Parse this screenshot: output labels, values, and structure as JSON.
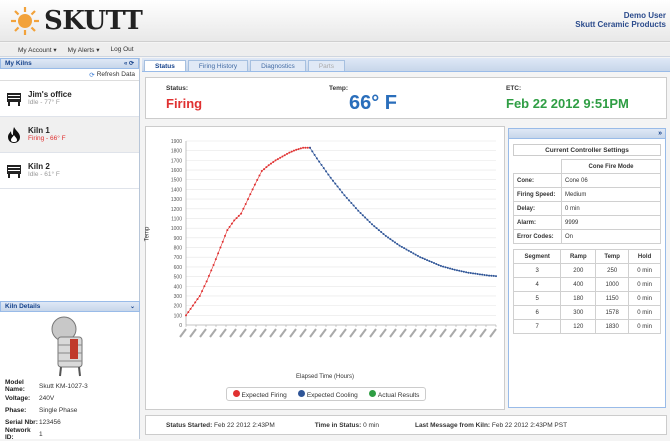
{
  "brand": {
    "name": "SKUTT"
  },
  "user": {
    "name": "Demo User",
    "company": "Skutt Ceramic Products"
  },
  "menu": {
    "account": "My Account ▾",
    "alerts": "My Alerts ▾",
    "logout": "Log Out"
  },
  "sidebar": {
    "title": "My Kilns",
    "refresh": "Refresh Data",
    "kilns": [
      {
        "name": "Jim's office",
        "status": "Idle  -  77° F"
      },
      {
        "name": "Kiln 1",
        "status": "Firing  -  66° F"
      },
      {
        "name": "Kiln 2",
        "status": "Idle  -  61° F"
      }
    ],
    "details_title": "Kiln Details",
    "details": [
      {
        "label": "Model Name:",
        "value": "Skutt KM-1027-3"
      },
      {
        "label": "Voltage:",
        "value": "240V"
      },
      {
        "label": "Phase:",
        "value": "Single Phase"
      },
      {
        "label": "Serial Nbr:",
        "value": "123456"
      },
      {
        "label": "Network ID:",
        "value": "1"
      }
    ]
  },
  "tabs": [
    "Status",
    "Firing History",
    "Diagnostics",
    "Parts"
  ],
  "status": {
    "status_label": "Status:",
    "status_value": "Firing",
    "temp_label": "Temp:",
    "temp_value": "66° F",
    "etc_label": "ETC:",
    "etc_value": "Feb 22 2012 9:51PM"
  },
  "colors": {
    "firing": "#e03131",
    "temp": "#2a6ebb",
    "etc": "#2f9e44",
    "cooling": "#2f5597",
    "expected_firing": "#e03131"
  },
  "chart_data": {
    "type": "scatter",
    "ylabel": "Temp",
    "xlabel": "Elapsed Time (Hours)",
    "ylim": [
      0,
      1900
    ],
    "yticks": [
      0,
      100,
      200,
      300,
      400,
      500,
      600,
      700,
      800,
      900,
      1000,
      1100,
      1200,
      1300,
      1400,
      1500,
      1600,
      1700,
      1800,
      1900
    ],
    "x_tick_count": 32,
    "series": [
      {
        "name": "Expected Firing",
        "x": [
          0,
          1,
          2,
          3,
          4,
          5,
          6,
          7,
          8,
          9,
          10,
          11,
          12,
          13,
          14,
          15,
          16,
          17,
          18
        ],
        "values": [
          100,
          200,
          300,
          450,
          620,
          800,
          980,
          1080,
          1150,
          1300,
          1450,
          1590,
          1650,
          1700,
          1740,
          1780,
          1810,
          1830,
          1830
        ]
      },
      {
        "name": "Expected Cooling",
        "x": [
          18,
          19,
          20,
          21,
          22,
          23,
          24,
          25,
          26,
          27,
          28,
          29,
          30,
          31,
          32,
          33,
          34,
          35,
          36,
          37,
          38,
          39,
          40,
          41,
          42,
          43,
          44,
          45
        ],
        "values": [
          1830,
          1720,
          1620,
          1520,
          1430,
          1340,
          1260,
          1180,
          1110,
          1040,
          980,
          920,
          870,
          820,
          780,
          740,
          700,
          670,
          640,
          610,
          590,
          570,
          555,
          540,
          530,
          520,
          510,
          505
        ]
      },
      {
        "name": "Actual Results",
        "x": [],
        "values": []
      }
    ],
    "legend": [
      "Expected Firing",
      "Expected Cooling",
      "Actual Results"
    ],
    "legend_position": "bottom",
    "grid": true
  },
  "controller": {
    "title": "Current Controller Settings",
    "mode": "Cone Fire Mode",
    "settings": [
      {
        "label": "Cone:",
        "value": "Cone 06"
      },
      {
        "label": "Firing Speed:",
        "value": "Medium"
      },
      {
        "label": "Delay:",
        "value": "0 min"
      },
      {
        "label": "Alarm:",
        "value": "9999"
      },
      {
        "label": "Error Codes:",
        "value": "On"
      }
    ],
    "seg_headers": [
      "Segment",
      "Ramp",
      "Temp",
      "Hold"
    ],
    "segments": [
      [
        "3",
        "200",
        "250",
        "0 min"
      ],
      [
        "4",
        "400",
        "1000",
        "0 min"
      ],
      [
        "5",
        "180",
        "1150",
        "0 min"
      ],
      [
        "6",
        "300",
        "1578",
        "0 min"
      ],
      [
        "7",
        "120",
        "1830",
        "0 min"
      ]
    ]
  },
  "footer": {
    "started_label": "Status Started:",
    "started_value": "Feb 22 2012 2:43PM",
    "time_label": "Time in Status:",
    "time_value": "0 min",
    "last_label": "Last Message from Kiln:",
    "last_value": "Feb 22 2012 2:43PM PST"
  }
}
